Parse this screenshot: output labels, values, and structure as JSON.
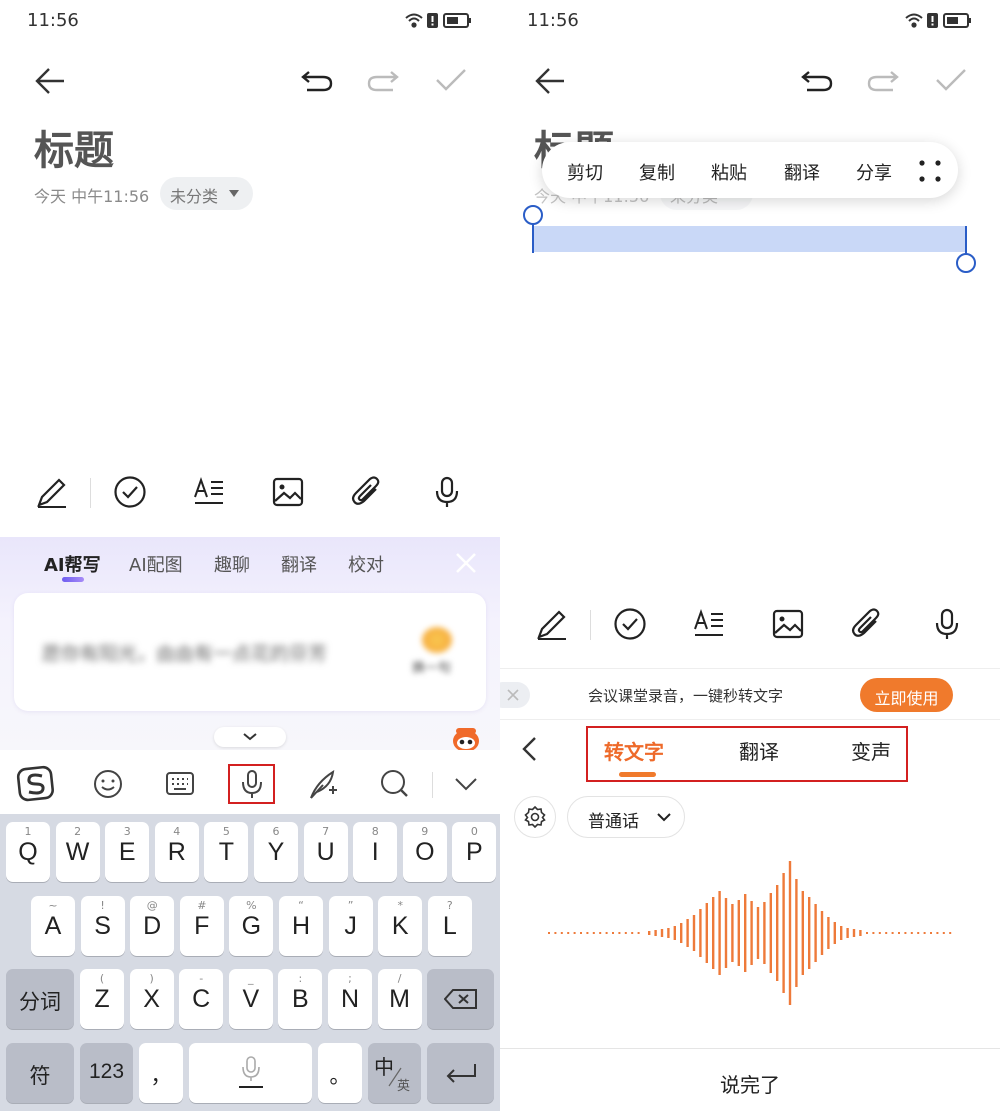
{
  "status_bar": {
    "time": "11:56"
  },
  "note": {
    "title": "标题",
    "meta_date": "今天 中午11:56",
    "category": "未分类"
  },
  "ai_panel": {
    "tabs": [
      {
        "label": "AI帮写",
        "active": true
      },
      {
        "label": "AI配图",
        "active": false
      },
      {
        "label": "趣聊",
        "active": false
      },
      {
        "label": "翻译",
        "active": false
      },
      {
        "label": "校对",
        "active": false
      }
    ],
    "suggestion_text": "愿你有阳光，由由有一点花的芬芳",
    "badge_text": "换一句"
  },
  "keyboard": {
    "row1": [
      {
        "hint": "1",
        "key": "Q"
      },
      {
        "hint": "2",
        "key": "W"
      },
      {
        "hint": "3",
        "key": "E"
      },
      {
        "hint": "4",
        "key": "R"
      },
      {
        "hint": "5",
        "key": "T"
      },
      {
        "hint": "6",
        "key": "Y"
      },
      {
        "hint": "7",
        "key": "U"
      },
      {
        "hint": "8",
        "key": "I"
      },
      {
        "hint": "9",
        "key": "O"
      },
      {
        "hint": "0",
        "key": "P"
      }
    ],
    "row2": [
      {
        "hint": "~",
        "key": "A"
      },
      {
        "hint": "!",
        "key": "S"
      },
      {
        "hint": "@",
        "key": "D"
      },
      {
        "hint": "#",
        "key": "F"
      },
      {
        "hint": "%",
        "key": "G"
      },
      {
        "hint": "“",
        "key": "H"
      },
      {
        "hint": "”",
        "key": "J"
      },
      {
        "hint": "*",
        "key": "K"
      },
      {
        "hint": "?",
        "key": "L"
      }
    ],
    "row3": [
      {
        "hint": "(",
        "key": "Z"
      },
      {
        "hint": ")",
        "key": "X"
      },
      {
        "hint": "-",
        "key": "C"
      },
      {
        "hint": "_",
        "key": "V"
      },
      {
        "hint": ":",
        "key": "B"
      },
      {
        "hint": ";",
        "key": "N"
      },
      {
        "hint": "/",
        "key": "M"
      }
    ],
    "fenci": "分词",
    "fu": "符",
    "num": "123",
    "comma": "，",
    "period": "。",
    "zh": "中",
    "en": "英"
  },
  "context_menu": {
    "items": [
      "剪切",
      "复制",
      "粘贴",
      "翻译",
      "分享"
    ]
  },
  "promo": {
    "text": "会议课堂录音，一键秒转文字",
    "button": "立即使用"
  },
  "voice_panel": {
    "tabs": [
      {
        "label": "转文字",
        "active": true
      },
      {
        "label": "翻译",
        "active": false
      },
      {
        "label": "变声",
        "active": false
      }
    ],
    "language": "普通话",
    "done": "说完了"
  },
  "colors": {
    "accent_orange": "#f07a2c",
    "highlight_red": "#d32020",
    "selection_blue": "#2a5dc7",
    "selection_fill": "#c9d8f7"
  }
}
